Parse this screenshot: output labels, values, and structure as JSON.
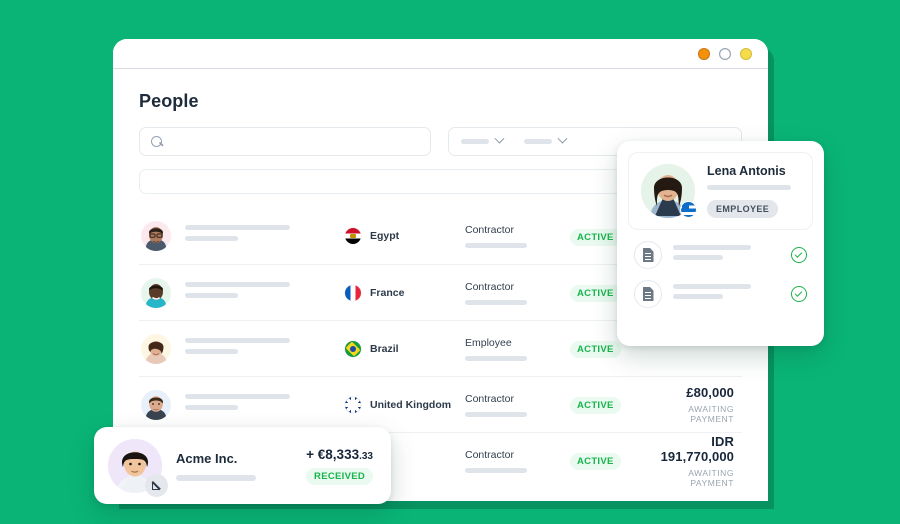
{
  "window": {
    "dots": [
      "orange",
      "white",
      "yellow"
    ]
  },
  "page": {
    "title": "People",
    "search": {
      "placeholder": ""
    },
    "filters": [
      {
        "label": "",
        "icon": "chevron-down-icon"
      },
      {
        "label": "",
        "icon": "chevron-down-icon"
      }
    ]
  },
  "table": {
    "rows": [
      {
        "country": "Egypt",
        "flag": "eg",
        "role": "Contractor",
        "status": "ACTIVE",
        "amount": "",
        "amount_sub": ""
      },
      {
        "country": "France",
        "flag": "fr",
        "role": "Contractor",
        "status": "ACTIVE",
        "amount": "",
        "amount_sub": ""
      },
      {
        "country": "Brazil",
        "flag": "br",
        "role": "Employee",
        "status": "ACTIVE",
        "amount": "",
        "amount_sub": ""
      },
      {
        "country": "United Kingdom",
        "flag": "uk",
        "role": "Contractor",
        "status": "ACTIVE",
        "amount": "£80,000",
        "amount_sub": "AWAITING PAYMENT"
      },
      {
        "country": "",
        "flag": "",
        "role": "Contractor",
        "status": "ACTIVE",
        "amount": "IDR  191,770,000",
        "amount_sub": "AWAITING PAYMENT"
      }
    ]
  },
  "person_card": {
    "name": "Lena Antonis",
    "flag": "gr",
    "type_badge": "EMPLOYEE",
    "documents": [
      {
        "icon": "document-icon",
        "status_icon": "check-circle-icon"
      },
      {
        "icon": "document-icon",
        "status_icon": "check-circle-icon"
      }
    ]
  },
  "payment_card": {
    "company": "Acme Inc.",
    "amount_main": "+ €8,333",
    "amount_cents": ".33",
    "status": "RECEIVED",
    "badge_icon": "arrow-down-left-icon"
  },
  "colors": {
    "background": "#0ab477",
    "accent_green": "#17b44a",
    "text_dark": "#1d2b3a"
  }
}
